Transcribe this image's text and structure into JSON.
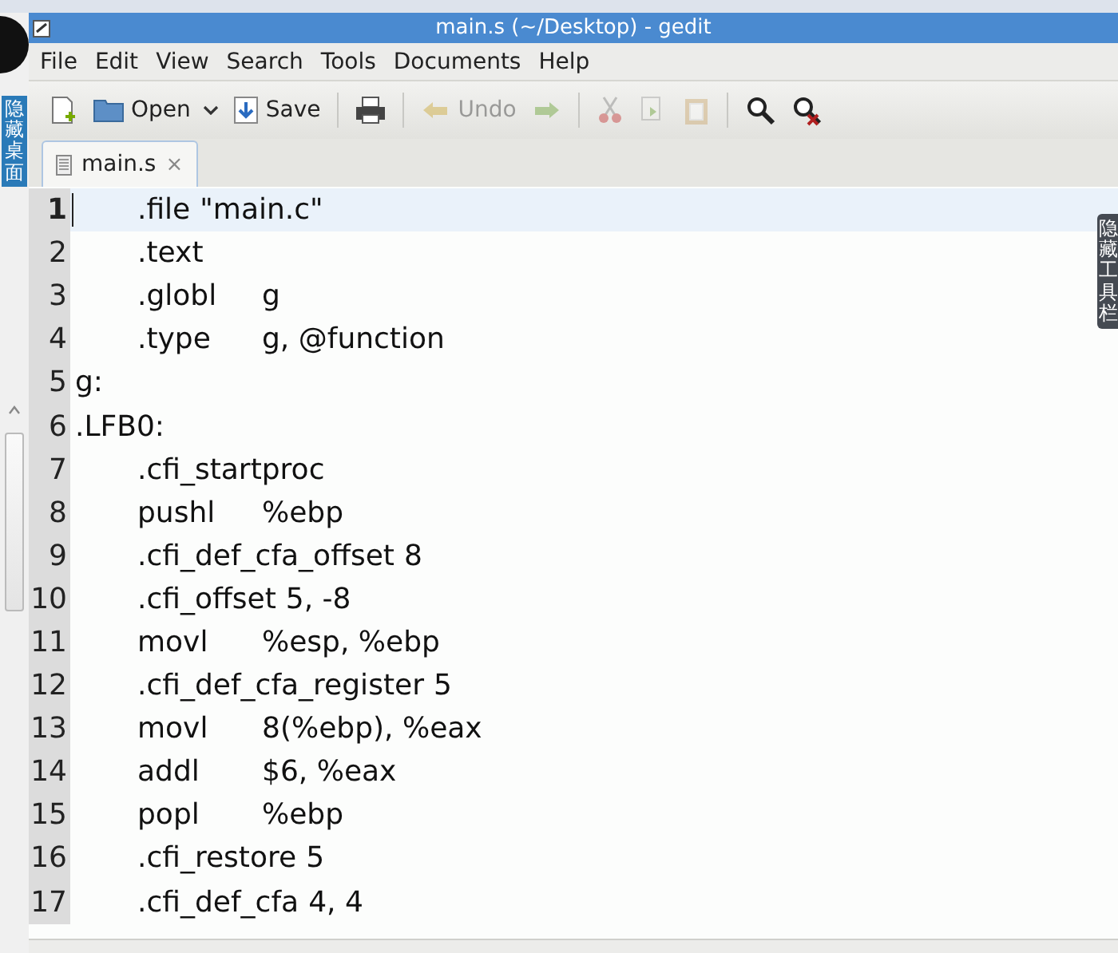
{
  "desktop": {
    "side_label": "隐藏桌面",
    "right_label": "隐藏工具栏"
  },
  "window": {
    "title": "main.s (~/Desktop) - gedit"
  },
  "menu": [
    "File",
    "Edit",
    "View",
    "Search",
    "Tools",
    "Documents",
    "Help"
  ],
  "toolbar": [
    {
      "kind": "new",
      "disabled": false
    },
    {
      "kind": "open",
      "label": "Open",
      "disabled": false
    },
    {
      "kind": "save",
      "label": "Save",
      "disabled": false
    },
    {
      "kind": "sep"
    },
    {
      "kind": "print",
      "disabled": false
    },
    {
      "kind": "sep"
    },
    {
      "kind": "undo",
      "label": "Undo",
      "disabled": true
    },
    {
      "kind": "redo",
      "disabled": true
    },
    {
      "kind": "sep"
    },
    {
      "kind": "cut",
      "disabled": true
    },
    {
      "kind": "copy",
      "disabled": true
    },
    {
      "kind": "paste",
      "disabled": true
    },
    {
      "kind": "sep"
    },
    {
      "kind": "find",
      "disabled": false
    },
    {
      "kind": "replace",
      "disabled": false
    }
  ],
  "tabs": [
    {
      "label": "main.s",
      "close": "×",
      "selected": true
    }
  ],
  "editor": {
    "lines": [
      {
        "number": "1",
        "kind": "directive",
        "op": ".file",
        "arg": "\"main.c\"",
        "current": true
      },
      {
        "number": "2",
        "kind": "directive",
        "op": ".text",
        "current": false
      },
      {
        "number": "3",
        "kind": "tabbed",
        "op": ".globl",
        "arg": "g",
        "current": false
      },
      {
        "number": "4",
        "kind": "tabbed",
        "op": ".type",
        "arg": "g, @function",
        "current": false
      },
      {
        "number": "5",
        "kind": "label",
        "op": "g:",
        "current": false
      },
      {
        "number": "6",
        "kind": "label",
        "op": ".LFB0:",
        "current": false
      },
      {
        "number": "7",
        "kind": "directive",
        "op": ".cfi_startproc",
        "current": false
      },
      {
        "number": "8",
        "kind": "tabbed",
        "op": "pushl",
        "arg": "%ebp",
        "current": false
      },
      {
        "number": "9",
        "kind": "directive",
        "op": ".cfi_def_cfa_offset",
        "arg": "8",
        "current": false
      },
      {
        "number": "10",
        "kind": "directive",
        "op": ".cfi_offset",
        "arg": "5, -8",
        "current": false
      },
      {
        "number": "11",
        "kind": "tabbed",
        "op": "movl",
        "arg": "%esp, %ebp",
        "current": false
      },
      {
        "number": "12",
        "kind": "directive",
        "op": ".cfi_def_cfa_register",
        "arg": "5",
        "current": false
      },
      {
        "number": "13",
        "kind": "tabbed",
        "op": "movl",
        "arg": "8(%ebp), %eax",
        "current": false
      },
      {
        "number": "14",
        "kind": "tabbed",
        "op": "addl",
        "arg": "$6, %eax",
        "current": false
      },
      {
        "number": "15",
        "kind": "tabbed",
        "op": "popl",
        "arg": "%ebp",
        "current": false
      },
      {
        "number": "16",
        "kind": "directive",
        "op": ".cfi_restore",
        "arg": "5",
        "current": false
      },
      {
        "number": "17",
        "kind": "directive",
        "op": ".cfi_def_cfa",
        "arg": "4, 4",
        "current": false
      }
    ]
  }
}
